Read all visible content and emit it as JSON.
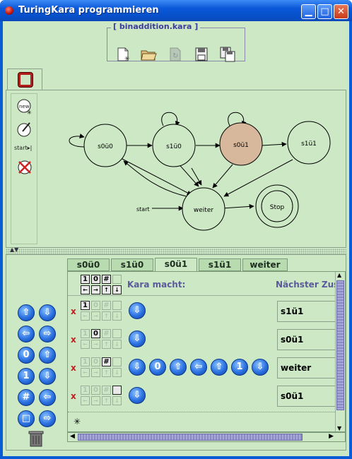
{
  "window": {
    "title": "TuringKara programmieren",
    "controls": [
      "minimize",
      "maximize",
      "close"
    ]
  },
  "file_toolbox": {
    "title": "[ binaddition.kara ]",
    "buttons": [
      "new-file-icon",
      "open-folder-icon",
      "reload-icon",
      "save-icon",
      "save-as-icon"
    ]
  },
  "graph": {
    "tools": {
      "new_label": "new",
      "start_label": "start"
    },
    "states": [
      {
        "name": "s0ü0",
        "highlighted": false
      },
      {
        "name": "s1ü0",
        "highlighted": false
      },
      {
        "name": "s0ü1",
        "highlighted": true
      },
      {
        "name": "s1ü1",
        "highlighted": false
      },
      {
        "name": "weiter",
        "highlighted": false
      },
      {
        "name": "Stop",
        "highlighted": false
      }
    ],
    "start_label": "start",
    "colors": {
      "highlight": "#d8b89c",
      "panel": "#cde8c4"
    }
  },
  "tabs": [
    "s0ü0",
    "s1ü0",
    "s0ü1",
    "s1ü1",
    "weiter"
  ],
  "active_tab": "s0ü1",
  "table": {
    "header_kara": "Kara macht:",
    "header_next": "Nächster Zustand",
    "rows": [
      {
        "read": "1",
        "actions": [
          "down"
        ],
        "next": "s1ü1"
      },
      {
        "read": "0",
        "actions": [
          "down"
        ],
        "next": "s0ü1"
      },
      {
        "read": "#",
        "actions": [
          "down",
          "0",
          "up",
          "left",
          "up",
          "1",
          "down"
        ],
        "next": "weiter"
      },
      {
        "read": "empty",
        "actions": [
          "down"
        ],
        "next": "s0ü1"
      }
    ],
    "header_symbols": [
      "1",
      "0",
      "#",
      ""
    ]
  },
  "command_pad": [
    "up",
    "down",
    "left",
    "right",
    "0",
    "up-over",
    "1",
    "down-over",
    "#",
    "left-over",
    "blank",
    "right-over"
  ]
}
